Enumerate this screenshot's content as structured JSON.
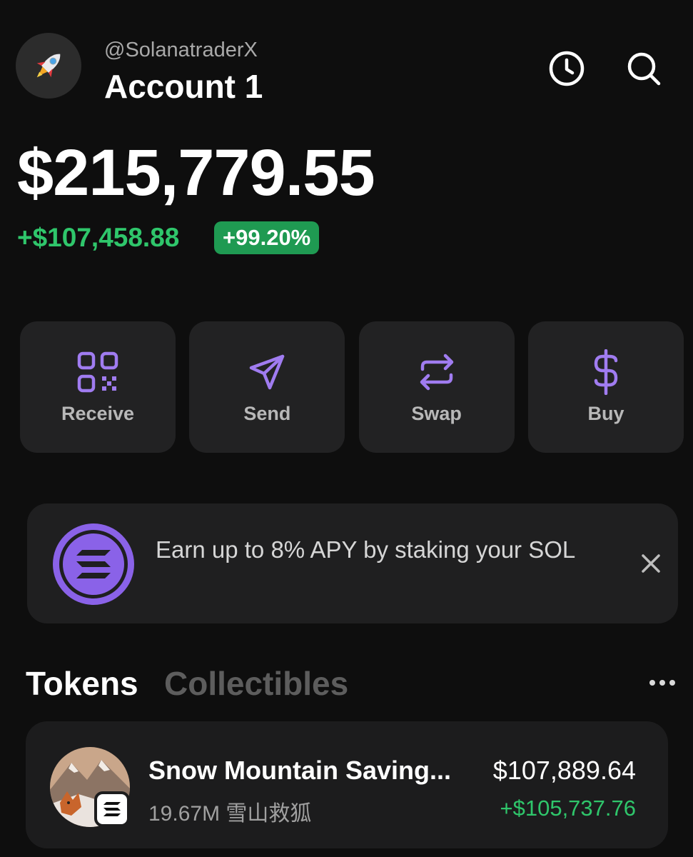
{
  "header": {
    "handle": "@SolanatraderX",
    "account_name": "Account 1",
    "avatar_icon": "rocket-icon",
    "history_icon": "clock-icon",
    "search_icon": "search-icon"
  },
  "portfolio": {
    "balance": "$215,779.55",
    "change_amount": "+$107,458.88",
    "change_percent": "+99.20%"
  },
  "actions": [
    {
      "label": "Receive",
      "icon": "qr-code-icon"
    },
    {
      "label": "Send",
      "icon": "send-icon"
    },
    {
      "label": "Swap",
      "icon": "swap-icon"
    },
    {
      "label": "Buy",
      "icon": "dollar-icon"
    }
  ],
  "promo": {
    "text": "Earn up to 8% APY by staking your SOL",
    "icon": "solana-icon",
    "close_icon": "close-icon"
  },
  "tabs": {
    "tokens": "Tokens",
    "collectibles": "Collectibles",
    "more_icon": "more-icon"
  },
  "tokens": [
    {
      "name": "Snow Mountain Saving...",
      "amount": "19.67M 雪山救狐",
      "value": "$107,889.64",
      "change": "+$105,737.76"
    }
  ],
  "colors": {
    "background": "#0e0e0e",
    "card": "#222223",
    "accent_purple": "#a07cf0",
    "positive_green": "#2fc66b"
  }
}
